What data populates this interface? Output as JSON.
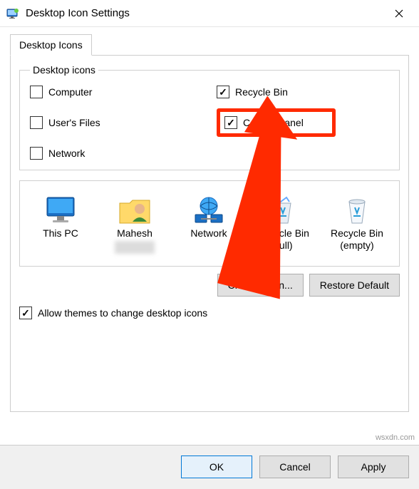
{
  "window": {
    "title": "Desktop Icon Settings"
  },
  "tabs": {
    "active": "Desktop Icons"
  },
  "desktop_icons_group": {
    "legend": "Desktop icons",
    "items": {
      "computer": {
        "label": "Computer",
        "checked": false
      },
      "recycle_bin": {
        "label": "Recycle Bin",
        "checked": true
      },
      "users_files": {
        "label": "User's Files",
        "checked": false
      },
      "control_panel": {
        "label": "Control Panel",
        "checked": true
      },
      "network": {
        "label": "Network",
        "checked": false
      }
    }
  },
  "icon_preview": {
    "this_pc": "This PC",
    "user": "Mahesh",
    "network": "Network",
    "recycle_full": "Recycle Bin (full)",
    "recycle_empty": "Recycle Bin (empty)"
  },
  "buttons": {
    "change_icon": "Change Icon...",
    "restore_default": "Restore Default",
    "ok": "OK",
    "cancel": "Cancel",
    "apply": "Apply"
  },
  "allow_themes": {
    "label": "Allow themes to change desktop icons",
    "checked": true
  },
  "watermark": "wsxdn.com"
}
